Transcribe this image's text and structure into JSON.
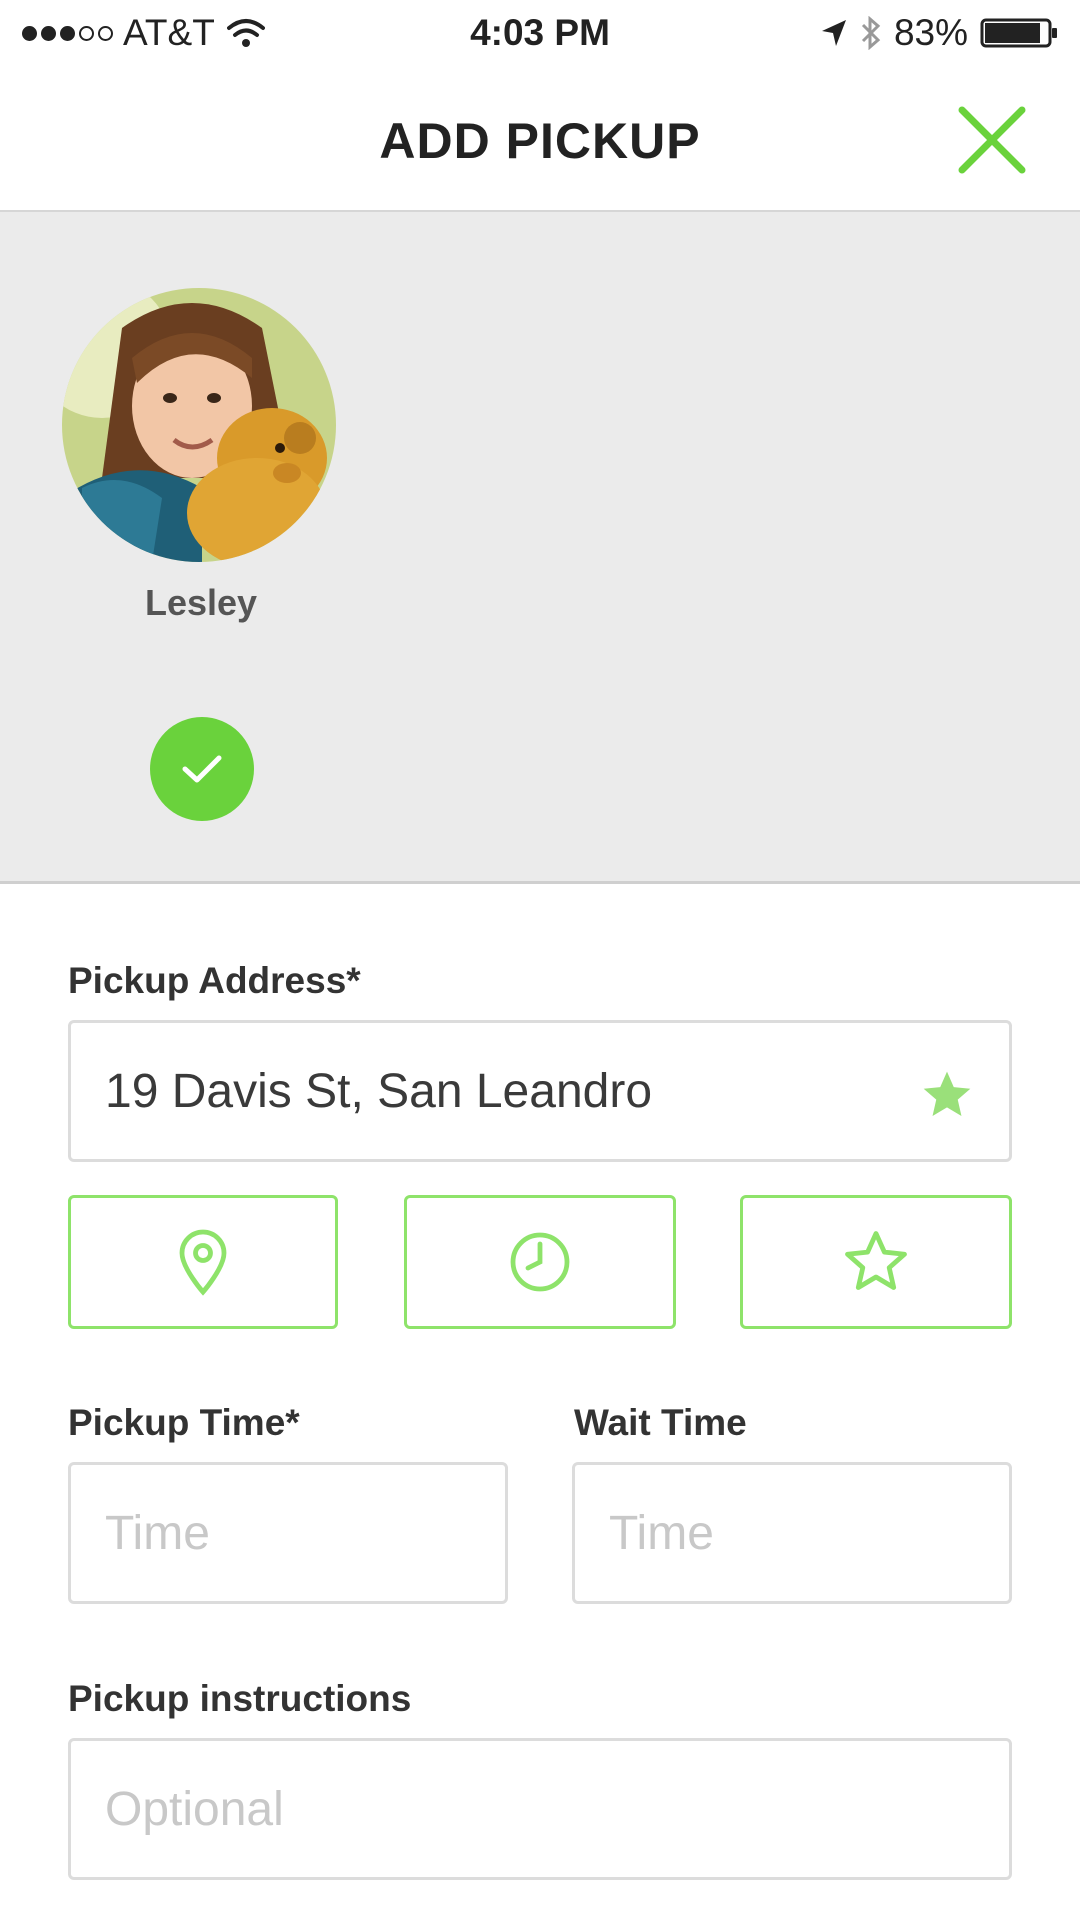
{
  "status_bar": {
    "carrier": "AT&T",
    "time": "4:03 PM",
    "battery": "83%",
    "battery_level": 0.83
  },
  "header": {
    "title": "ADD PICKUP",
    "close_icon": "close-x-icon",
    "accent_color": "#6ad23c"
  },
  "rider": {
    "name": "Lesley",
    "selected": true
  },
  "form": {
    "pickup_address": {
      "label": "Pickup Address*",
      "value": "19 Davis St, San Leandro",
      "favorite_icon": "star-icon"
    },
    "quick_actions": [
      {
        "icon": "location-pin-icon"
      },
      {
        "icon": "clock-icon"
      },
      {
        "icon": "star-outline-icon"
      }
    ],
    "pickup_time": {
      "label": "Pickup Time*",
      "placeholder": "Time"
    },
    "wait_time": {
      "label": "Wait Time",
      "placeholder": "Time"
    },
    "pickup_instructions": {
      "label": "Pickup instructions",
      "placeholder": "Optional"
    }
  }
}
